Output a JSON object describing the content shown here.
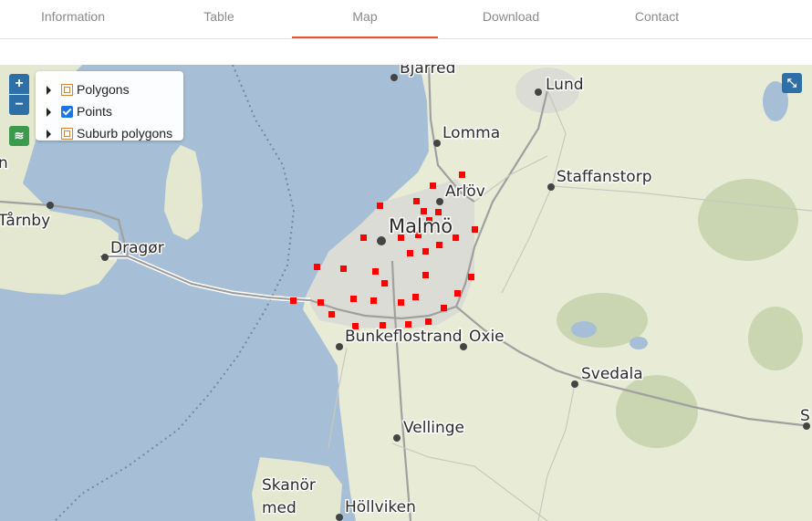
{
  "tabs": [
    {
      "label": "Information",
      "active": false
    },
    {
      "label": "Table",
      "active": false
    },
    {
      "label": "Map",
      "active": true
    },
    {
      "label": "Download",
      "active": false
    },
    {
      "label": "Contact",
      "active": false
    }
  ],
  "accent_color": "#e4572e",
  "map": {
    "controls": {
      "zoom_in": "+",
      "zoom_out": "−",
      "layers_icon": "layers-icon",
      "fullscreen_icon": "expand-icon"
    },
    "layers": [
      {
        "label": "Polygons",
        "checked": false
      },
      {
        "label": "Points",
        "checked": true
      },
      {
        "label": "Suburb polygons",
        "checked": false
      }
    ],
    "places": [
      "Bjärred",
      "Lund",
      "Lomma",
      "Staffanstorp",
      "Arlöv",
      "Malmö",
      "Tårnby",
      "Dragør",
      "Bunkeflostrand",
      "Oxie",
      "Svedala",
      "Vellinge",
      "Skanör",
      "med",
      "Höllviken",
      "n",
      "S"
    ],
    "point_color": "#ff0000",
    "water_color": "#a6bfd6",
    "land_color": "#e8ecd6"
  }
}
